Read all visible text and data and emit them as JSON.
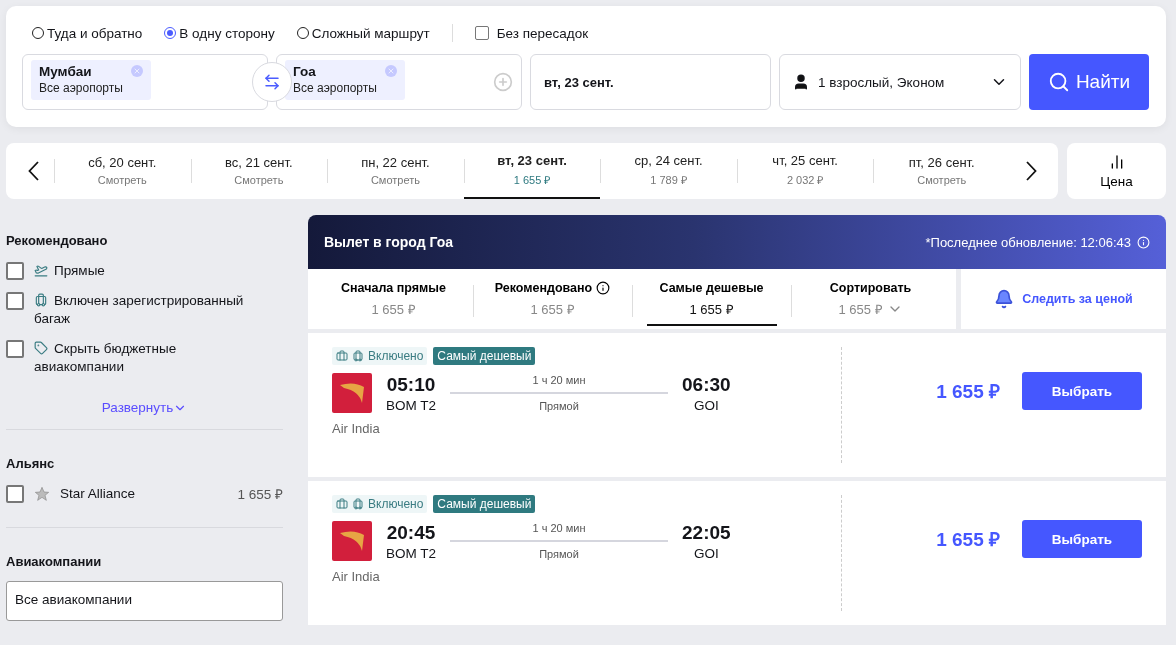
{
  "search": {
    "trip_types": [
      {
        "label": "Туда и обратно",
        "selected": false
      },
      {
        "label": "В одну сторону",
        "selected": true
      },
      {
        "label": "Сложный маршрут",
        "selected": false
      }
    ],
    "nonstop": {
      "label": "Без пересадок",
      "checked": false
    },
    "from": {
      "city": "Мумбаи",
      "sub": "Все аэропорты"
    },
    "to": {
      "city": "Гоа",
      "sub": "Все аэропорты"
    },
    "date": "вт, 23 сент.",
    "passengers": "1 взрослый, Эконом",
    "search_button": "Найти"
  },
  "dates": [
    {
      "date": "сб, 20 сент.",
      "price": "Смотреть",
      "selected": false
    },
    {
      "date": "вс, 21 сент.",
      "price": "Смотреть",
      "selected": false
    },
    {
      "date": "пн, 22 сент.",
      "price": "Смотреть",
      "selected": false
    },
    {
      "date": "вт, 23 сент.",
      "price": "1 655 ₽",
      "selected": true
    },
    {
      "date": "ср, 24 сент.",
      "price": "1 789 ₽",
      "selected": false
    },
    {
      "date": "чт, 25 сент.",
      "price": "2 032 ₽",
      "selected": false
    },
    {
      "date": "пт, 26 сент.",
      "price": "Смотреть",
      "selected": false
    }
  ],
  "price_chart_button": "Цена",
  "sidebar": {
    "recommended": {
      "title": "Рекомендовано",
      "filters": [
        {
          "kind": "direct",
          "label": "Прямые",
          "checked": false
        },
        {
          "kind": "baggage",
          "label": "Включен зарегистрированный багаж",
          "checked": false
        },
        {
          "kind": "budget",
          "label": "Скрыть бюджетные авиакомпании",
          "checked": false
        }
      ],
      "expand": "Развернуть"
    },
    "alliance": {
      "title": "Альянс",
      "items": [
        {
          "label": "Star Alliance",
          "price": "1 655 ₽",
          "checked": false
        }
      ]
    },
    "airlines": {
      "title": "Авиакомпании",
      "value": "Все авиакомпании"
    }
  },
  "results": {
    "title": "Вылет в город Гоа",
    "updated": "*Последнее обновление: 12:06:43",
    "sort_tabs": [
      {
        "kind": "plain",
        "label": "Сначала прямые",
        "price": "1 655 ₽",
        "selected": false
      },
      {
        "kind": "info",
        "label": "Рекомендовано",
        "price": "1 655 ₽",
        "selected": false
      },
      {
        "kind": "plain",
        "label": "Самые дешевые",
        "price": "1 655 ₽",
        "selected": true
      },
      {
        "kind": "dropdown",
        "label": "Сортировать",
        "price": "1 655 ₽",
        "selected": false
      }
    ],
    "watch_price": "Следить за ценой",
    "flights": [
      {
        "baggage": "Включено",
        "badge": "Самый дешевый",
        "dep_time": "05:10",
        "dep_airport": "BOM T2",
        "duration": "1 ч 20 мин",
        "stops": "Прямой",
        "arr_time": "06:30",
        "arr_airport": "GOI",
        "airline": "Air India",
        "price": "1 655 ₽",
        "button": "Выбрать"
      },
      {
        "baggage": "Включено",
        "badge": "Самый дешевый",
        "dep_time": "20:45",
        "dep_airport": "BOM T2",
        "duration": "1 ч 20 мин",
        "stops": "Прямой",
        "arr_time": "22:05",
        "arr_airport": "GOI",
        "airline": "Air India",
        "price": "1 655 ₽",
        "button": "Выбрать"
      }
    ]
  }
}
